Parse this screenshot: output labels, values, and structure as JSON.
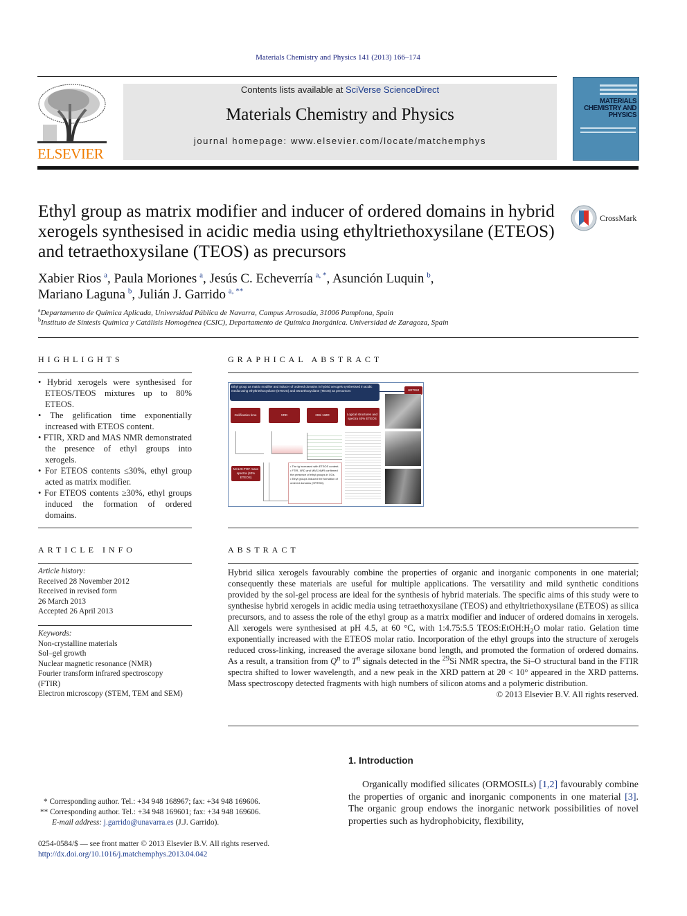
{
  "header": {
    "citation": "Materials Chemistry and Physics 141 (2013) 166–174",
    "contents_prefix": "Contents lists available at ",
    "contents_link": "SciVerse ScienceDirect",
    "journal_title": "Materials Chemistry and Physics",
    "homepage_prefix": "journal homepage: ",
    "homepage_url": "www.elsevier.com/locate/matchemphys",
    "publisher_logo": "ELSEVIER",
    "cover_title": "MATERIALS CHEMISTRY AND PHYSICS"
  },
  "article": {
    "title": "Ethyl group as matrix modifier and inducer of ordered domains in hybrid xerogels synthesised in acidic media using ethyltriethoxysilane (ETEOS) and tetraethoxysilane (TEOS) as precursors",
    "crossmark": "CrossMark",
    "authors": [
      {
        "name": "Xabier Rios",
        "sup": "a",
        "sep": ", "
      },
      {
        "name": "Paula Moriones",
        "sup": "a",
        "sep": ", "
      },
      {
        "name": "Jesús C. Echeverría",
        "sup": "a, *",
        "sep": ", "
      },
      {
        "name": "Asunción Luquin",
        "sup": "b",
        "sep": ","
      },
      {
        "name": "Mariano Laguna",
        "sup": "b",
        "sep": ", "
      },
      {
        "name": "Julián J. Garrido",
        "sup": "a, **",
        "sep": ""
      }
    ],
    "affiliations": [
      {
        "sup": "a",
        "text": "Departamento de Química Aplicada, Universidad Pública de Navarra, Campus Arrosadía, 31006 Pamplona, Spain"
      },
      {
        "sup": "b",
        "text": "Instituto de Síntesis Química y Catálisis Homogénea (CSIC), Departamento de Química Inorgánica. Universidad de Zaragoza, Spain"
      }
    ]
  },
  "highlights": {
    "heading": "HIGHLIGHTS",
    "items": [
      "Hybrid xerogels were synthesised for ETEOS/TEOS mixtures up to 80% ETEOS.",
      "The gelification time exponentially increased with ETEOS content.",
      "FTIR, XRD and MAS NMR demonstrated the presence of ethyl groups into xerogels.",
      "For ETEOS contents ≤30%, ethyl group acted as matrix modifier.",
      "For ETEOS contents ≥30%, ethyl groups induced the formation of ordered domains."
    ]
  },
  "graphical_abstract": {
    "heading": "GRAPHICAL ABSTRACT",
    "header_text": "Ethyl group as matrix modifier and inducer of ordered domains in hybrid xerogels synthesised in acidic media using ethyltriethoxysilane (ETEOS) and tetraethoxysilane (TEOS) as precursors",
    "boxes": [
      "Gelification time",
      "XRD",
      "29Si NMR",
      "Logical structures and spectra 40% ETEOS",
      "MALDI-TOF mass spectra (40% ETEOS)",
      "HRTEM"
    ],
    "bullets": [
      "The tg increased with ETEOS content.",
      "FTIR, XRD and MAS-NMR confirmed the presence of ethyl groups in XGs.",
      "Ethyl groups induced the formation of ordered domains (HRTEM)."
    ]
  },
  "article_info": {
    "heading": "ARTICLE INFO",
    "history_label": "Article history:",
    "history": [
      "Received 28 November 2012",
      "Received in revised form",
      "26 March 2013",
      "Accepted 26 April 2013"
    ],
    "keywords_label": "Keywords:",
    "keywords": [
      "Non-crystalline materials",
      "Sol–gel growth",
      "Nuclear magnetic resonance (NMR)",
      "Fourier transform infrared spectroscopy",
      "(FTIR)",
      "Electron microscopy (STEM, TEM and SEM)"
    ]
  },
  "abstract": {
    "heading": "ABSTRACT",
    "p1": "Hybrid silica xerogels favourably combine the properties of organic and inorganic components in one material; consequently these materials are useful for multiple applications. The versatility and mild synthetic conditions provided by the sol-gel process are ideal for the synthesis of hybrid materials. The specific aims of this study were to synthesise hybrid xerogels in acidic media using tetraethoxysilane (TEOS) and ethyltriethoxysilane (ETEOS) as silica precursors, and to assess the role of the ethyl group as a matrix modifier and inducer of ordered domains in xerogels. All xerogels were synthesised at pH 4.5, at 60 °C, with 1:4.75:5.5 TEOS:EtOH:H",
    "sub2": "2",
    "p2": "O molar ratio. Gelation time exponentially increased with the ETEOS molar ratio. Incorporation of the ethyl groups into the structure of xerogels reduced cross-linking, increased the average siloxane bond length, and promoted the formation of ordered domains. As a result, a transition from ",
    "q": "Q",
    "n1": "n",
    "to": " to ",
    "t": "T",
    "n2": "n",
    "p3": " signals detected in the ",
    "sup29": "29",
    "p4": "Si NMR spectra, the Si–O structural band in the FTIR spectra shifted to lower wavelength, and a new peak in the XRD pattern at 2θ < 10° appeared in the XRD patterns. Mass spectroscopy detected fragments with high numbers of silicon atoms and a polymeric distribution.",
    "copyright": "© 2013 Elsevier B.V. All rights reserved."
  },
  "introduction": {
    "heading": "1.  Introduction",
    "t1": "Organically modified silicates (ORMOSILs) ",
    "ref1": "[1,2]",
    "t2": " favourably combine the properties of organic and inorganic components in one material ",
    "ref2": "[3]",
    "t3": ". The organic group endows the inorganic network possibilities of novel properties such as hydrophobicity, flexibility,"
  },
  "footnotes": {
    "corr1": "*   Corresponding author. Tel.: +34 948 168967; fax: +34 948 169606.",
    "corr2": "**  Corresponding author. Tel.: +34 948 169601; fax: +34 948 169606.",
    "email_label": "E-mail address: ",
    "email": "j.garrido@unavarra.es",
    "email_suffix": " (J.J. Garrido).",
    "front_matter": "0254-0584/$ — see front matter © 2013 Elsevier B.V. All rights reserved.",
    "doi": "http://dx.doi.org/10.1016/j.matchemphys.2013.04.042"
  },
  "colors": {
    "link": "#1a3a8c",
    "elsevier_orange": "#f07d00",
    "banner_grey": "#e6e6e6",
    "cover_blue": "#4d8cb4",
    "ga_red": "#8e1a1e",
    "ga_navy": "#1f3560"
  }
}
